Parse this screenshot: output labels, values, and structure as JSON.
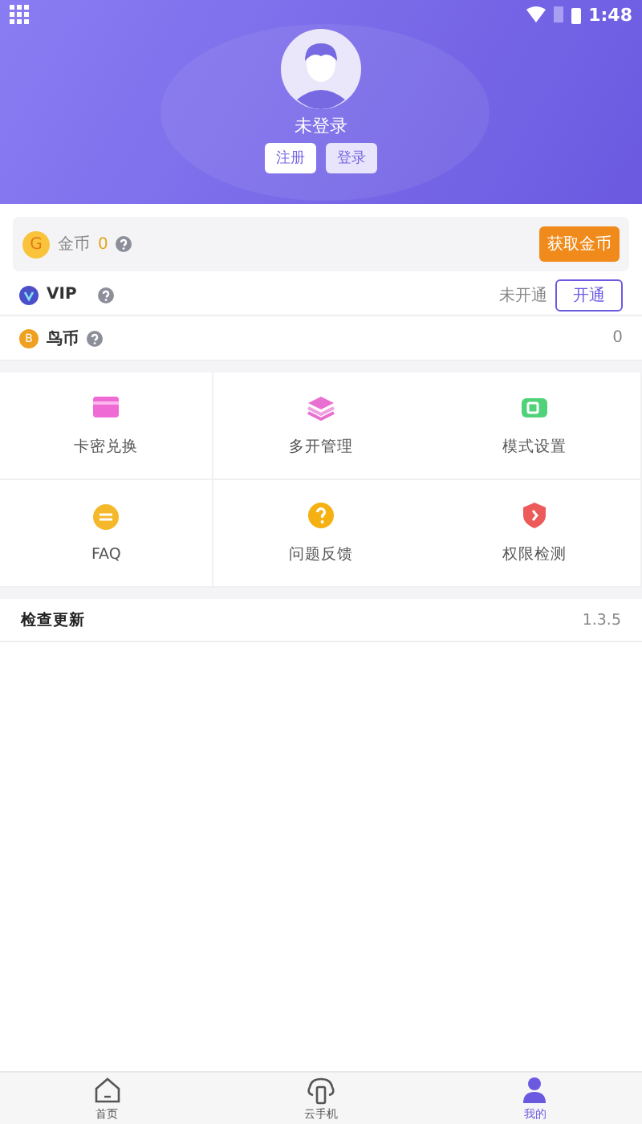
{
  "status_bar": {
    "time": "1:48"
  },
  "profile": {
    "name": "未登录",
    "buttons": [
      {
        "label": "注册",
        "kind": "primary"
      },
      {
        "label": "登录",
        "kind": "secondary"
      }
    ]
  },
  "coins": {
    "label": "金币",
    "value": "0",
    "badge": "G",
    "button": "获取金币"
  },
  "vip": {
    "label": "VIP",
    "status": "未开通",
    "button": "开通"
  },
  "bird_coins": {
    "label": "鸟币",
    "badge": "B",
    "value": "0"
  },
  "grid": [
    {
      "label": "卡密兑换",
      "kind": "card"
    },
    {
      "label": "多开管理",
      "kind": "layers"
    },
    {
      "label": "模式设置",
      "kind": "mode"
    },
    {
      "label": "FAQ",
      "kind": "faq"
    },
    {
      "label": "问题反馈",
      "kind": "question"
    },
    {
      "label": "权限检测",
      "kind": "shield"
    }
  ],
  "update": {
    "label": "检查更新",
    "version": "1.3.5"
  },
  "nav": [
    {
      "label": "首页",
      "kind": "home",
      "selected": false
    },
    {
      "label": "云手机",
      "kind": "cloud",
      "selected": false
    },
    {
      "label": "我的",
      "kind": "person",
      "selected": true
    }
  ]
}
